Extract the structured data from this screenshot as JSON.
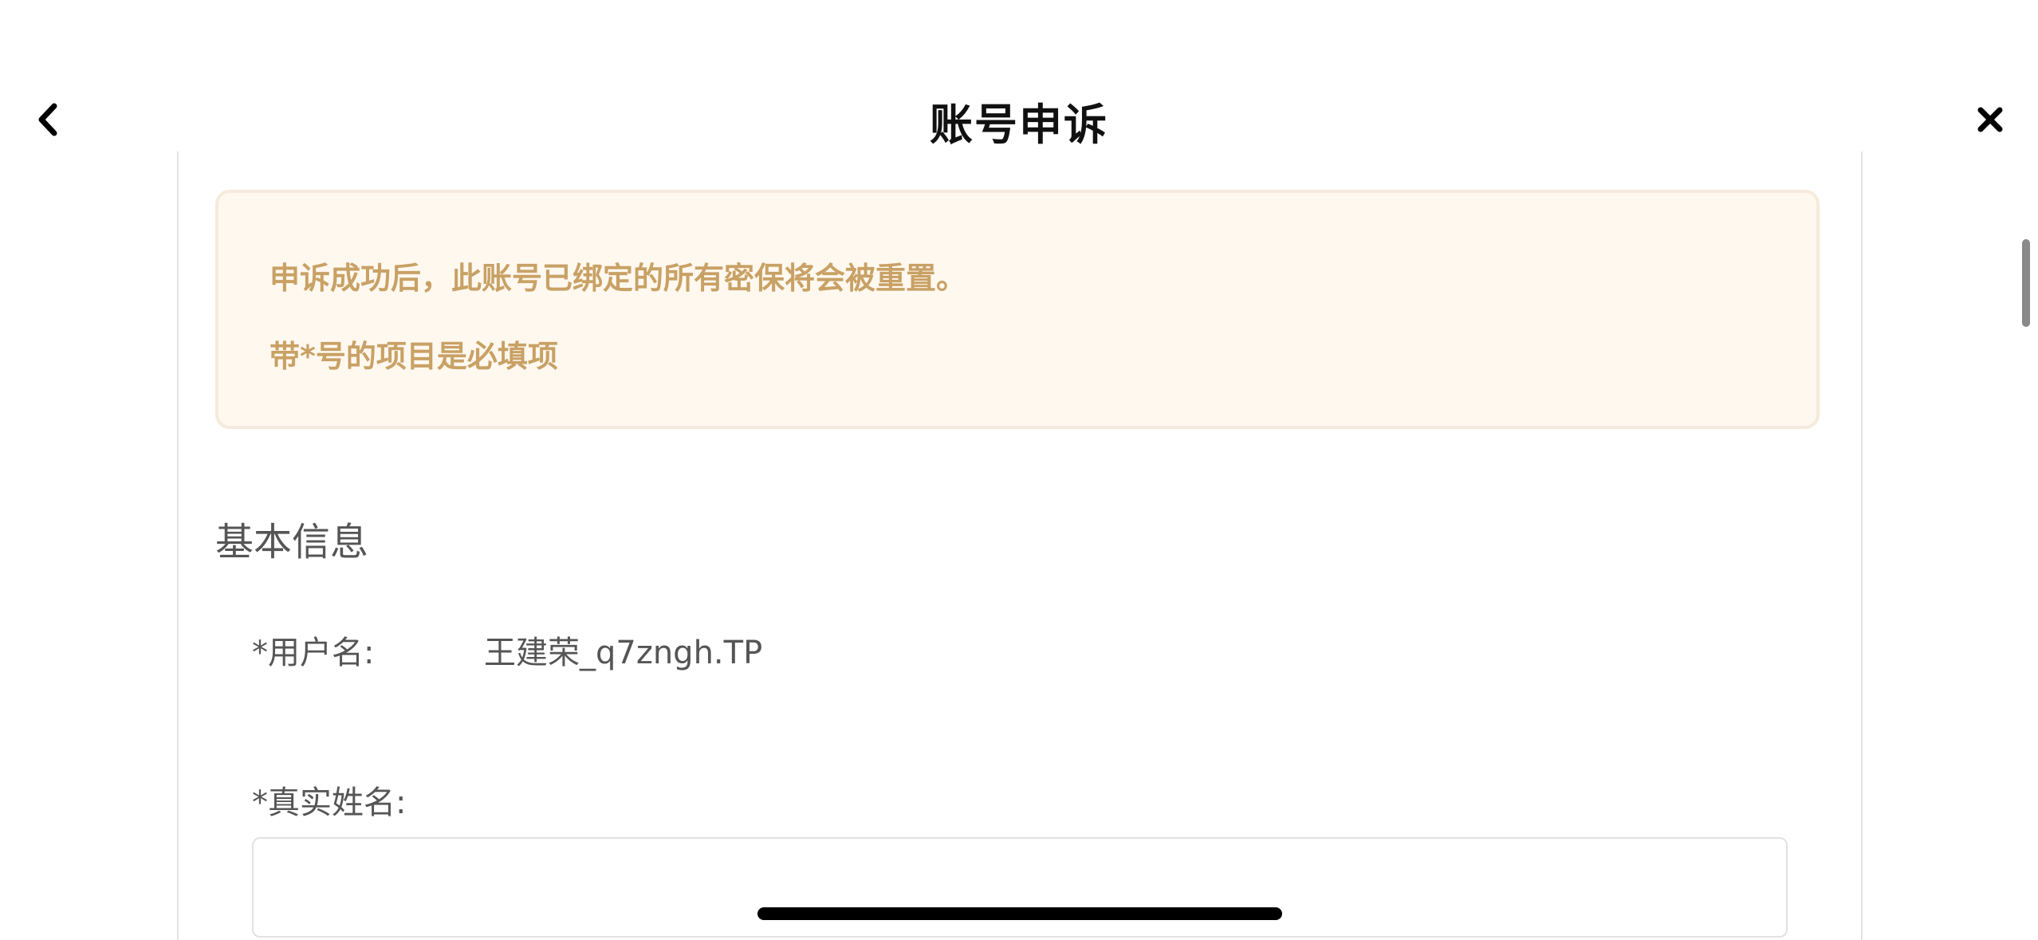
{
  "header": {
    "title": "账号申诉",
    "back_icon": "chevron-left-icon",
    "close_icon": "close-icon"
  },
  "notice": {
    "lines": [
      "申诉成功后，此账号已绑定的所有密保将会被重置。",
      "带*号的项目是必填项"
    ],
    "text_color": "#c8a165",
    "background_color": "#fff8ef"
  },
  "basic_info": {
    "section_title": "基本信息",
    "username": {
      "label": "*用户名:",
      "value": "王建荣_q7zngh.TP"
    },
    "real_name": {
      "label": "*真实姓名:",
      "value": "",
      "placeholder": ""
    }
  }
}
